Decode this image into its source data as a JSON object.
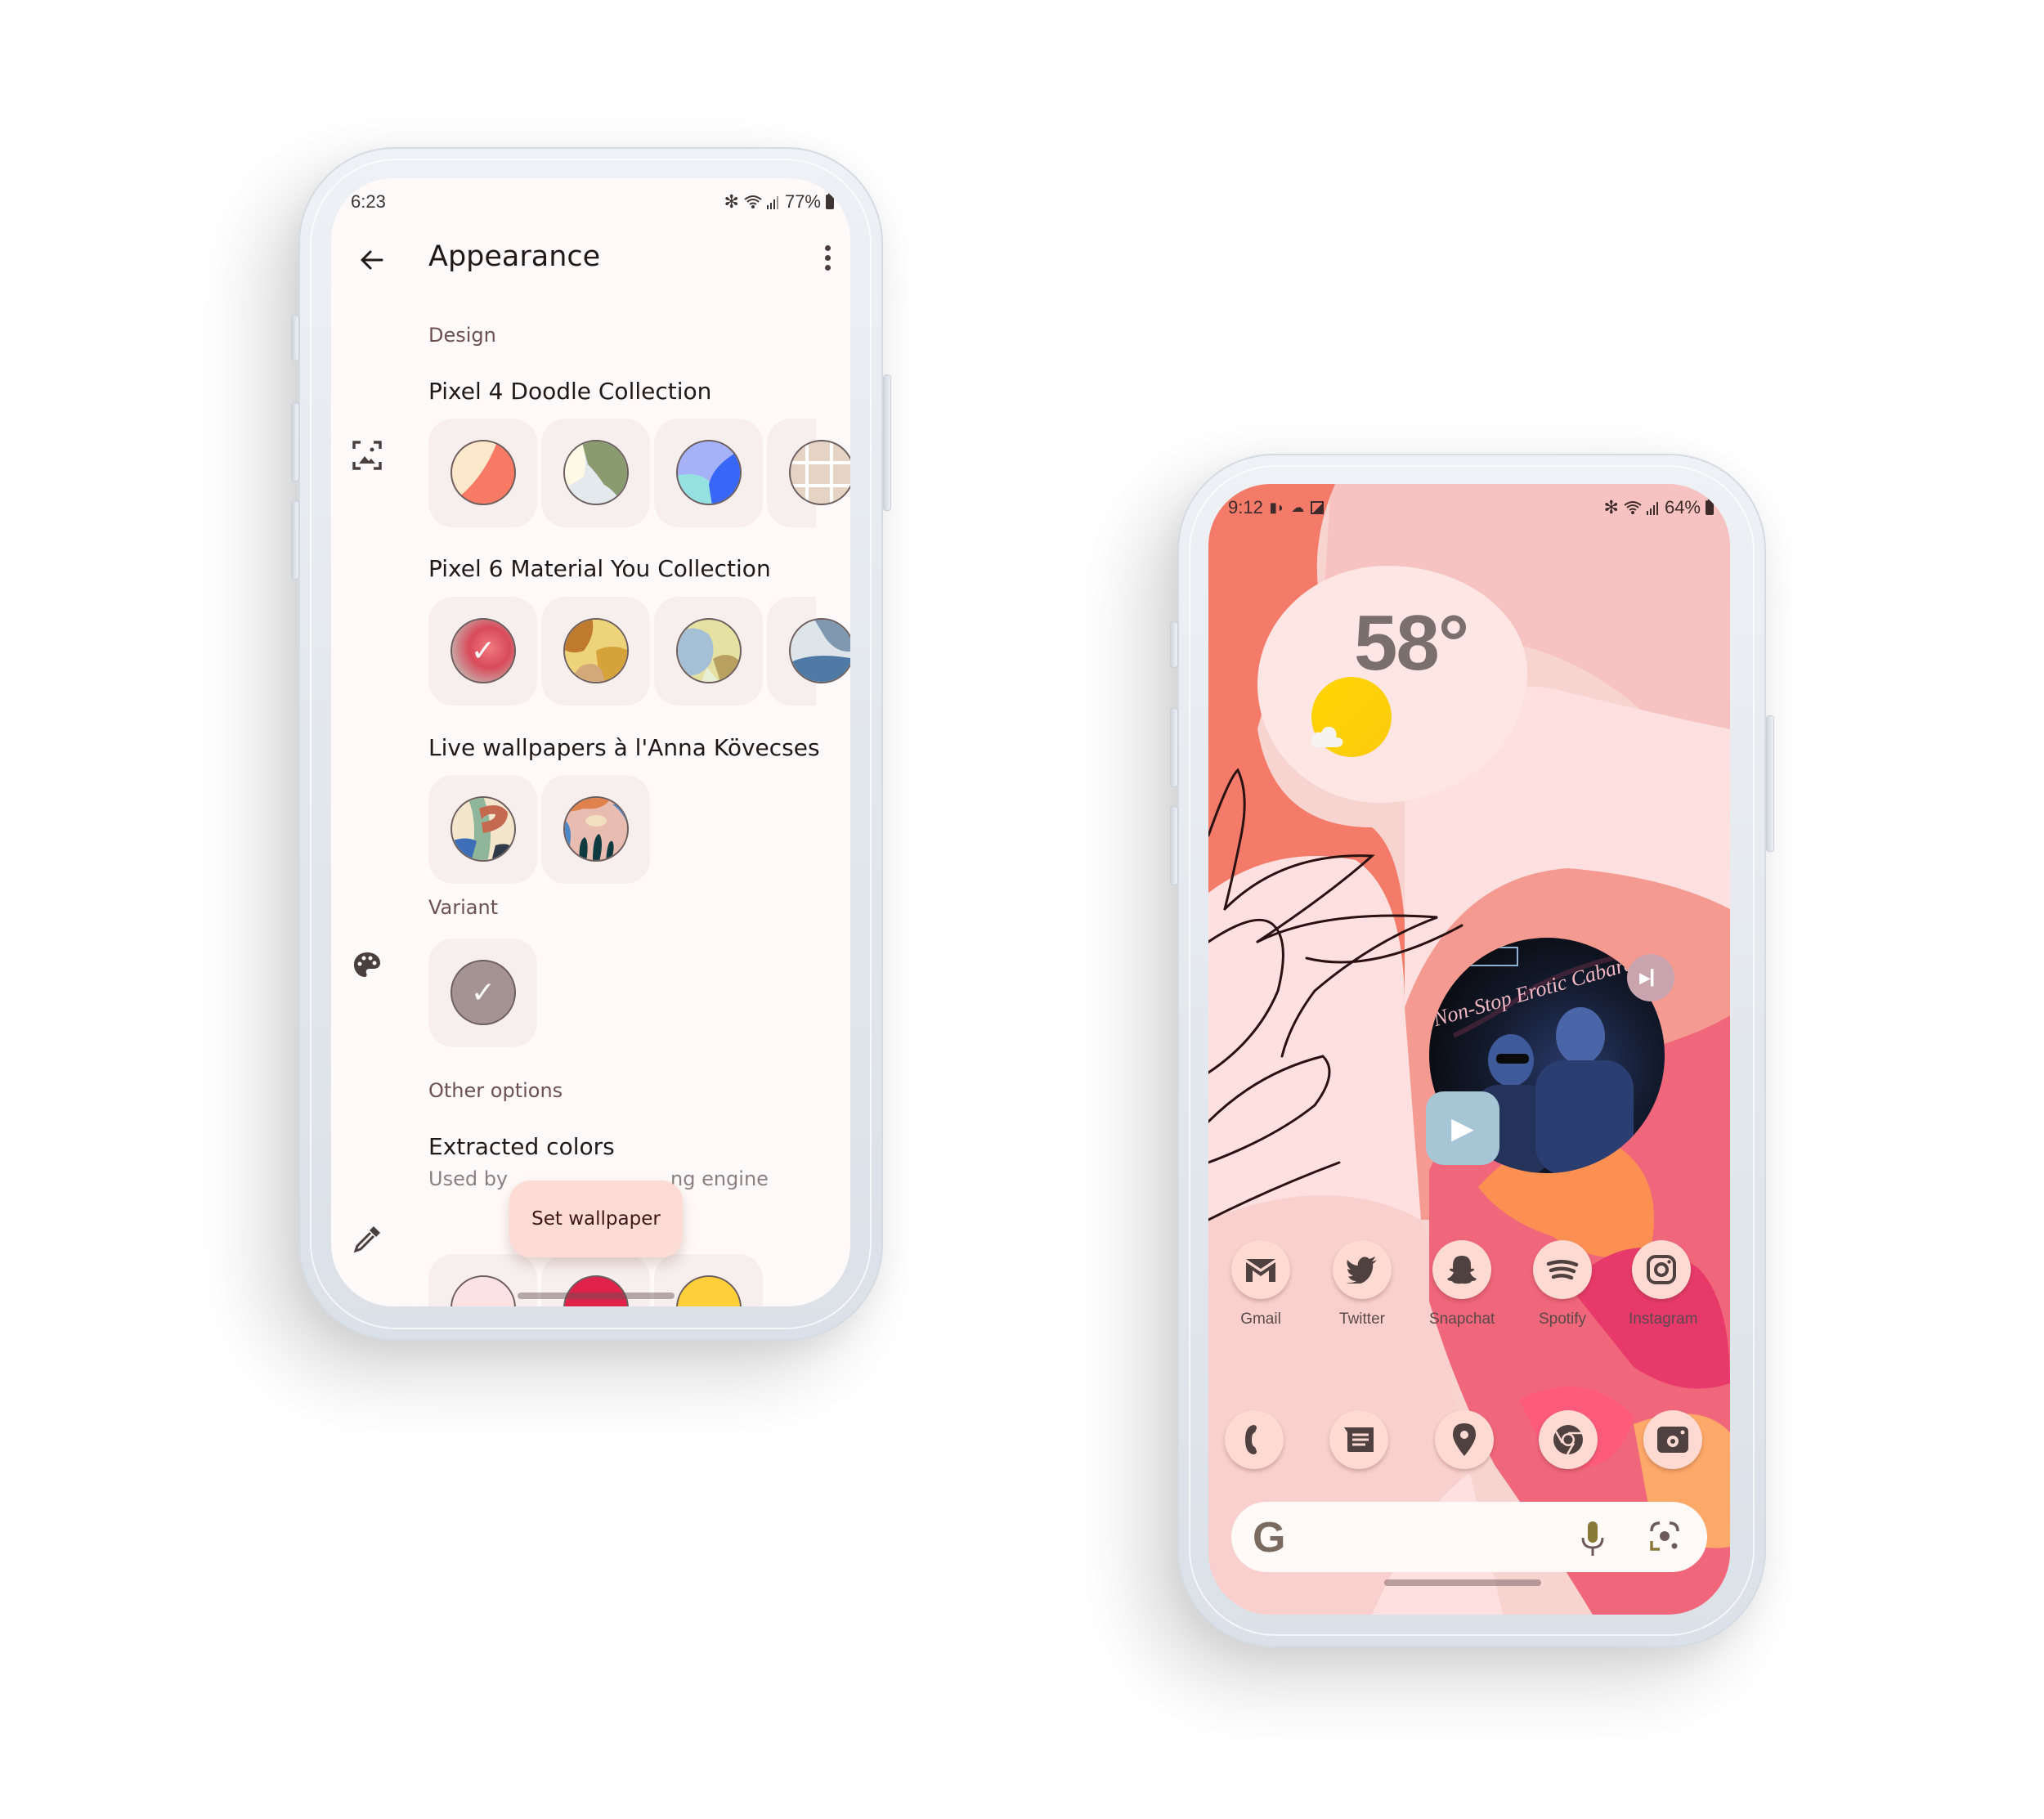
{
  "left_phone": {
    "status_bar": {
      "time": "6:23",
      "battery": "77%",
      "icons": [
        "bluetooth-icon",
        "wifi-icon",
        "signal-icon",
        "battery-icon"
      ]
    },
    "app_bar": {
      "title": "Appearance",
      "back_icon": "arrow-back-icon",
      "menu_icon": "more-vert-icon"
    },
    "sections": {
      "design_label": "Design",
      "collections": [
        {
          "title": "Pixel 4 Doodle Collection",
          "items": [
            "doodle-peach-coral",
            "doodle-sage-cream",
            "doodle-blue-teal",
            "doodle-beige-grid"
          ]
        },
        {
          "title": "Pixel 6 Material You Collection",
          "items": [
            "floral-pink-selected",
            "ochre-leaf",
            "blue-olive",
            "blue-splash"
          ],
          "selected_index": 0
        },
        {
          "title": "Live wallpapers à l'Anna Kövecses",
          "items": [
            "anna-kovecses-1",
            "anna-kovecses-2"
          ]
        }
      ],
      "variant_label": "Variant",
      "variant_selected": true,
      "variant_color": "#a59393",
      "other_options_label": "Other options",
      "extracted_colors": {
        "title": "Extracted colors",
        "subtitle_visible_start": "Used by",
        "subtitle_visible_end": "ng engine",
        "colors": [
          "#fde2e4",
          "#e0214a",
          "#ffcf3a"
        ]
      }
    },
    "side_icons": [
      "wallpaper-icon",
      "palette-icon",
      "color-picker-icon"
    ],
    "fab": {
      "label": "Set wallpaper"
    }
  },
  "right_phone": {
    "status_bar": {
      "time": "9:12",
      "battery": "64%",
      "left_icons": [
        "notification-d-icon",
        "cloud-icon",
        "image-icon"
      ],
      "right_icons": [
        "bluetooth-icon",
        "wifi-icon",
        "signal-icon",
        "battery-icon"
      ]
    },
    "weather": {
      "temperature": "58°",
      "condition_icon": "partly-sunny-icon"
    },
    "media": {
      "album_text": "Non-Stop Erotic Cabaret",
      "play_icon": "play-icon",
      "skip_icon": "skip-next-icon"
    },
    "apps_row": [
      {
        "label": "Gmail",
        "icon": "gmail-icon"
      },
      {
        "label": "Twitter",
        "icon": "twitter-icon"
      },
      {
        "label": "Snapchat",
        "icon": "snapchat-icon"
      },
      {
        "label": "Spotify",
        "icon": "spotify-icon"
      },
      {
        "label": "Instagram",
        "icon": "instagram-icon"
      }
    ],
    "dock": [
      {
        "icon": "phone-icon"
      },
      {
        "icon": "messages-icon"
      },
      {
        "icon": "maps-icon"
      },
      {
        "icon": "chrome-icon"
      },
      {
        "icon": "camera-icon"
      }
    ],
    "search_bar": {
      "logo": "G",
      "mic_icon": "mic-icon",
      "lens_icon": "lens-icon"
    }
  },
  "colors": {
    "screen_bg": "#fffaf9",
    "tile_bg": "#f6efed",
    "accent_text": "#6d5050",
    "fab_bg": "#fddcd5",
    "app_icon_bg": "#fedad2",
    "wallpaper_coral": "#f47b69",
    "wallpaper_pink": "#f8d4d1"
  }
}
